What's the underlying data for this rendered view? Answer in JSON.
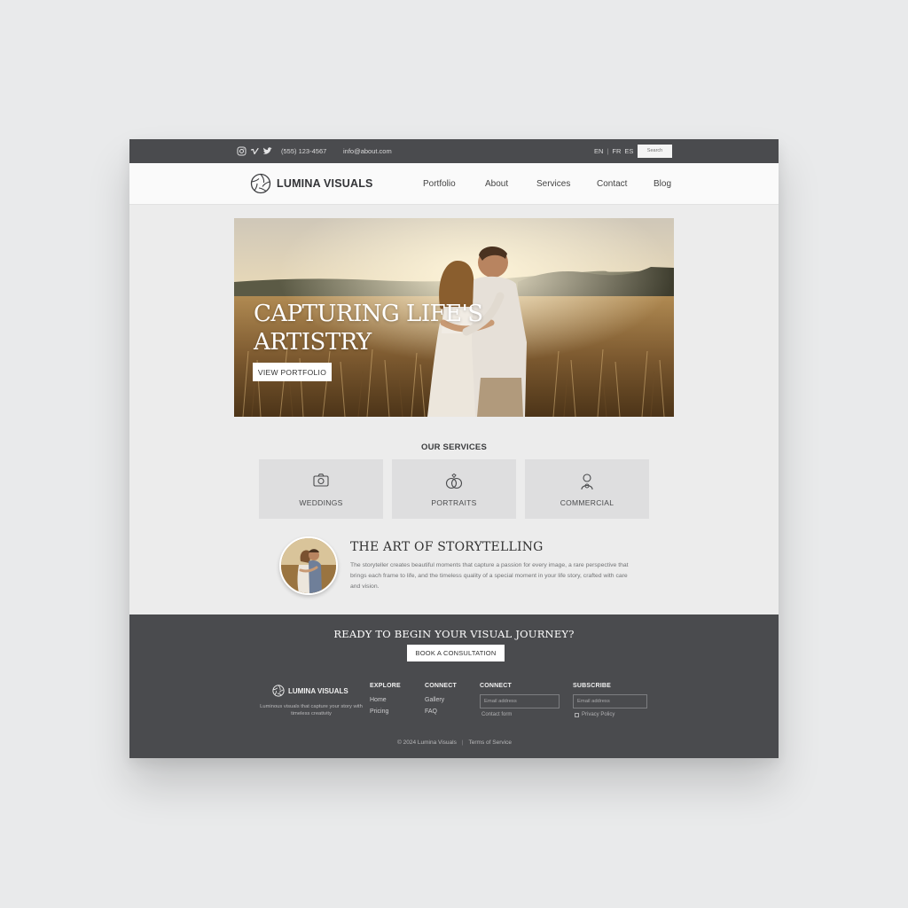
{
  "topbar": {
    "socials": [
      "instagram-icon",
      "vimeo-icon",
      "twitter-icon"
    ],
    "phone": "(555) 123-4567",
    "email": "info@about.com",
    "languages": [
      "EN",
      "FR",
      "ES"
    ],
    "lang_separator": "|",
    "mini_input_placeholder": "Search"
  },
  "nav": {
    "brand": "LUMINA VISUALS",
    "links": [
      "Portfolio",
      "About",
      "Services",
      "Contact",
      "Blog"
    ]
  },
  "hero": {
    "headline_line1": "CAPTURING LIFE'S",
    "headline_line2": "ARTISTRY",
    "cta": "VIEW PORTFOLIO"
  },
  "services": {
    "title": "OUR SERVICES",
    "items": [
      {
        "label": "WEDDINGS",
        "icon": "camera-icon"
      },
      {
        "label": "PORTRAITS",
        "icon": "rings-icon"
      },
      {
        "label": "COMMERCIAL",
        "icon": "portrait-icon"
      }
    ]
  },
  "story": {
    "title": "THE ART OF STORYTELLING",
    "body": "The storyteller creates beautiful moments that capture a passion for every image, a rare perspective that brings each frame to life, and the timeless quality of a special moment in your life story, crafted with care and vision."
  },
  "footer": {
    "cta_title": "READY TO BEGIN YOUR VISUAL JOURNEY?",
    "cta_button": "BOOK A CONSULTATION",
    "brand": "LUMINA VISUALS",
    "tagline": "Luminous visuals that capture your story with timeless creativity",
    "columns": [
      {
        "heading": "EXPLORE",
        "items": [
          "Home",
          "Pricing"
        ]
      },
      {
        "heading": "CONNECT",
        "items": [
          "Gallery",
          "FAQ"
        ]
      }
    ],
    "contact_heading": "CONNECT",
    "contact_placeholder": "Email address",
    "contact_note": "Contact form",
    "subscribe_heading": "SUBSCRIBE",
    "subscribe_placeholder": "Email address",
    "subscribe_note": "Privacy Policy",
    "copyright": "© 2024 Lumina Visuals",
    "copy_separator": "|",
    "terms": "Terms of Service"
  }
}
